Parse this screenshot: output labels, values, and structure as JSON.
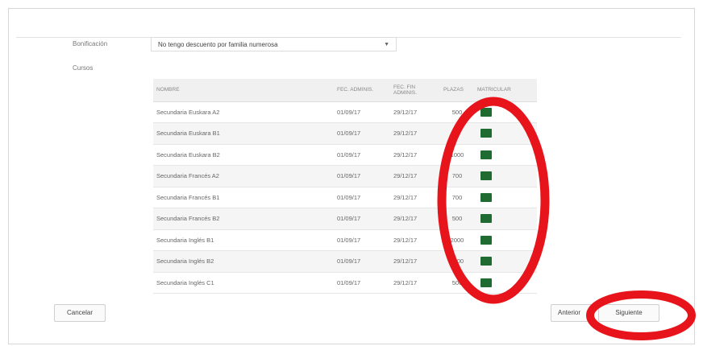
{
  "form": {
    "bonus_label": "Bonificación",
    "bonus_select_value": "No tengo descuento por familia numerosa",
    "courses_label": "Cursos"
  },
  "table": {
    "headers": {
      "nombre": "NOMBRE",
      "fec_admin": "FEC. ADMINIS.",
      "fec_fin": "FEC. FIN ADMINIS.",
      "plazas": "PLAZAS",
      "matricular": "MATRICULAR"
    },
    "rows": [
      {
        "nombre": "Secundaria Euskara A2",
        "fec_admin": "01/09/17",
        "fec_fin": "29/12/17",
        "plazas": "500"
      },
      {
        "nombre": "Secundaria Euskara B1",
        "fec_admin": "01/09/17",
        "fec_fin": "29/12/17",
        "plazas": "0"
      },
      {
        "nombre": "Secundaria Euskara B2",
        "fec_admin": "01/09/17",
        "fec_fin": "29/12/17",
        "plazas": "1000"
      },
      {
        "nombre": "Secundaria Francés A2",
        "fec_admin": "01/09/17",
        "fec_fin": "29/12/17",
        "plazas": "700"
      },
      {
        "nombre": "Secundaria Francés B1",
        "fec_admin": "01/09/17",
        "fec_fin": "29/12/17",
        "plazas": "700"
      },
      {
        "nombre": "Secundaria Francés B2",
        "fec_admin": "01/09/17",
        "fec_fin": "29/12/17",
        "plazas": "500"
      },
      {
        "nombre": "Secundaria Inglés B1",
        "fec_admin": "01/09/17",
        "fec_fin": "29/12/17",
        "plazas": "2000"
      },
      {
        "nombre": "Secundaria Inglés B2",
        "fec_admin": "01/09/17",
        "fec_fin": "29/12/17",
        "plazas": "1100"
      },
      {
        "nombre": "Secundaria Inglés C1",
        "fec_admin": "01/09/17",
        "fec_fin": "29/12/17",
        "plazas": "500"
      }
    ]
  },
  "buttons": {
    "cancel": "Cancelar",
    "previous": "Anterior",
    "next": "Siguiente"
  },
  "colors": {
    "enroll_button": "#1f6b31",
    "annotation": "#e8141b"
  }
}
